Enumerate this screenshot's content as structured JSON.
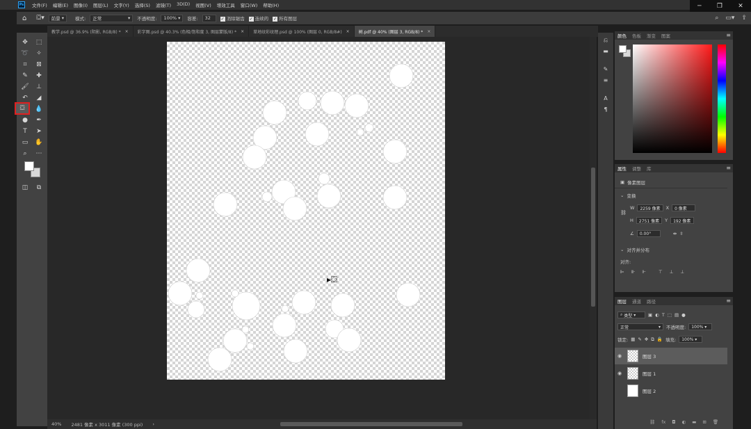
{
  "menu": [
    "文件(F)",
    "编辑(E)",
    "图像(I)",
    "图层(L)",
    "文字(Y)",
    "选择(S)",
    "滤镜(T)",
    "3D(D)",
    "视图(V)",
    "增效工具",
    "窗口(W)",
    "帮助(H)"
  ],
  "app_logo": "Ps",
  "window_controls": {
    "minimize": "─",
    "restore": "❐",
    "close": "✕"
  },
  "options": {
    "fill_source": "前景",
    "mode_label": "模式:",
    "mode_value": "正常",
    "opacity_label": "不透明度:",
    "opacity_value": "100%",
    "tolerance_label": "容差:",
    "tolerance_value": "32",
    "antialias_label": "消除锯齿",
    "contiguous_label": "连续的",
    "all_layers_label": "所有图层"
  },
  "tabs": [
    {
      "label": "教学.psd @ 36.9% (阴影, RGB/8) *"
    },
    {
      "label": "彩字图.psd @ 40.3% (色相/饱和度 3, 图层蒙版/8) *"
    },
    {
      "label": "草地纹彩纹理.psd @ 100% (图层 0, RGB/8#)"
    },
    {
      "label": "树.pdf @ 40% (图层 3, RGB/8) *"
    }
  ],
  "status": {
    "zoom": "40%",
    "doc_info": "2481 像素 x 3011 像素 (300 ppi)"
  },
  "color_panel": {
    "tabs": [
      "颜色",
      "色板",
      "渐变",
      "图案"
    ]
  },
  "properties_panel": {
    "tabs": [
      "属性",
      "调整",
      "库"
    ],
    "layer_type": "像素图层",
    "transform_title": "变换",
    "w_label": "W",
    "w_value": "2259 像素",
    "x_label": "X",
    "x_value": "0 像素",
    "h_label": "H",
    "h_value": "2751 像素",
    "y_label": "Y",
    "y_value": "192 像素",
    "angle_value": "0.00°",
    "align_title": "对齐并分布",
    "align_label": "对齐:"
  },
  "layers_panel": {
    "tabs": [
      "图层",
      "通道",
      "路径"
    ],
    "filter_label": "类型",
    "blend_mode": "正常",
    "opacity_label": "不透明度:",
    "opacity_value": "100%",
    "lock_label": "锁定:",
    "fill_label": "填充:",
    "fill_value": "100%",
    "layers": [
      {
        "name": "图层 3",
        "selected": true,
        "visible": true
      },
      {
        "name": "图层 1",
        "selected": false,
        "visible": true
      },
      {
        "name": "图层 2",
        "selected": false,
        "visible": false
      }
    ]
  },
  "colors": {
    "accent_red": "#e02020",
    "panel_bg": "#424242",
    "canvas_bg": "#282828"
  }
}
